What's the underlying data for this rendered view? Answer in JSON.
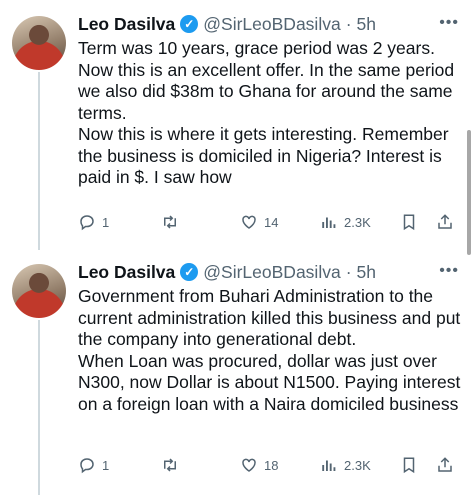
{
  "tweets": [
    {
      "name": "Leo Dasilva",
      "handle": "@SirLeoBDasilva",
      "time": "5h",
      "text": [
        "Term was 10 years, grace period was 2 years. Now this is an excellent offer. In the same period we also did $38m to Ghana for around the same terms.",
        "Now this is where it gets interesting. Remember the business is domiciled in Nigeria? Interest is paid in $. I saw how"
      ],
      "replies": "1",
      "retweets": "",
      "likes": "14",
      "views": "2.3K"
    },
    {
      "name": "Leo Dasilva",
      "handle": "@SirLeoBDasilva",
      "time": "5h",
      "text": [
        "Government from Buhari Administration to the current administration killed this business and put the company into generational debt.",
        "When Loan was procured, dollar was just over N300, now Dollar is about N1500. Paying interest on a foreign loan with a Naira domiciled business"
      ],
      "replies": "1",
      "retweets": "",
      "likes": "18",
      "views": "2.3K"
    }
  ],
  "icons": {
    "verified": "verified-badge-icon",
    "more": "more-icon",
    "reply": "reply-icon",
    "retweet": "retweet-icon",
    "like": "like-icon",
    "views": "views-icon",
    "bookmark": "bookmark-icon",
    "share": "share-icon"
  },
  "colors": {
    "verified": "#1d9bf0",
    "secondary_text": "#536471",
    "thread_line": "#cfd9de"
  }
}
